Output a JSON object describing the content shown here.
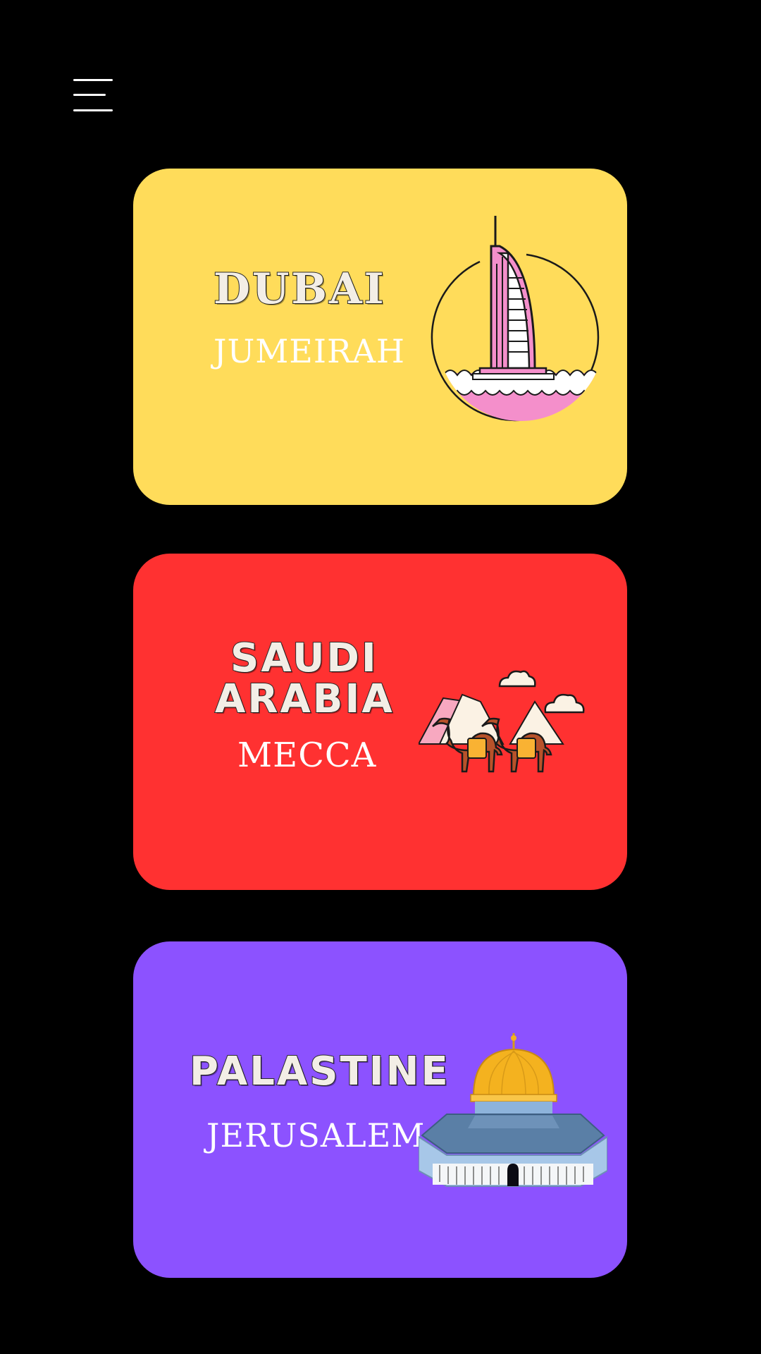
{
  "menu": {
    "icon": "hamburger-menu-icon"
  },
  "cards": [
    {
      "title": "DUBAI",
      "subtitle": "JUMEIRAH",
      "color": "#FFDC5A",
      "icon": "burj-al-arab-icon"
    },
    {
      "title_line1": "SAUDI",
      "title_line2": "ARABIA",
      "subtitle": "MECCA",
      "color": "#FF3131",
      "icon": "camels-desert-icon"
    },
    {
      "title": "PALASTINE",
      "subtitle": "JERUSALEM",
      "color": "#8C52FF",
      "icon": "dome-of-the-rock-icon"
    }
  ]
}
